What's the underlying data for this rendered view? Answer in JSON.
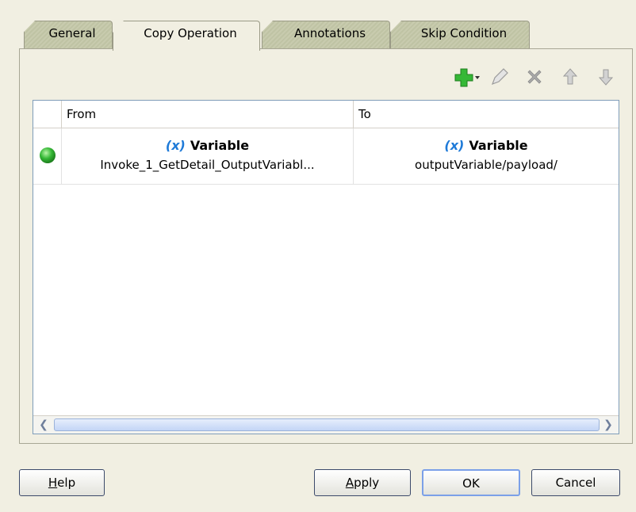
{
  "tabs": [
    {
      "label": "General"
    },
    {
      "label": "Copy Operation"
    },
    {
      "label": "Annotations"
    },
    {
      "label": "Skip Condition"
    }
  ],
  "active_tab": "Copy Operation",
  "toolbar": {
    "icons": [
      "add-icon",
      "edit-icon",
      "delete-icon",
      "move-up-icon",
      "move-down-icon"
    ]
  },
  "table": {
    "columns": [
      "From",
      "To"
    ],
    "rows": [
      {
        "status": "green",
        "from": {
          "type_symbol": "(x)",
          "type": "Variable",
          "value": "Invoke_1_GetDetail_OutputVariabl..."
        },
        "to": {
          "type_symbol": "(x)",
          "type": "Variable",
          "value": "outputVariable/payload/"
        }
      }
    ]
  },
  "buttons": {
    "help": {
      "mnemonic": "H",
      "rest": "elp"
    },
    "apply": {
      "mnemonic": "A",
      "rest": "pply"
    },
    "ok": "OK",
    "cancel": "Cancel"
  },
  "colors": {
    "status_green": "#35b836",
    "variable_icon": "#1e7ad8",
    "add_icon": "#35b836"
  }
}
